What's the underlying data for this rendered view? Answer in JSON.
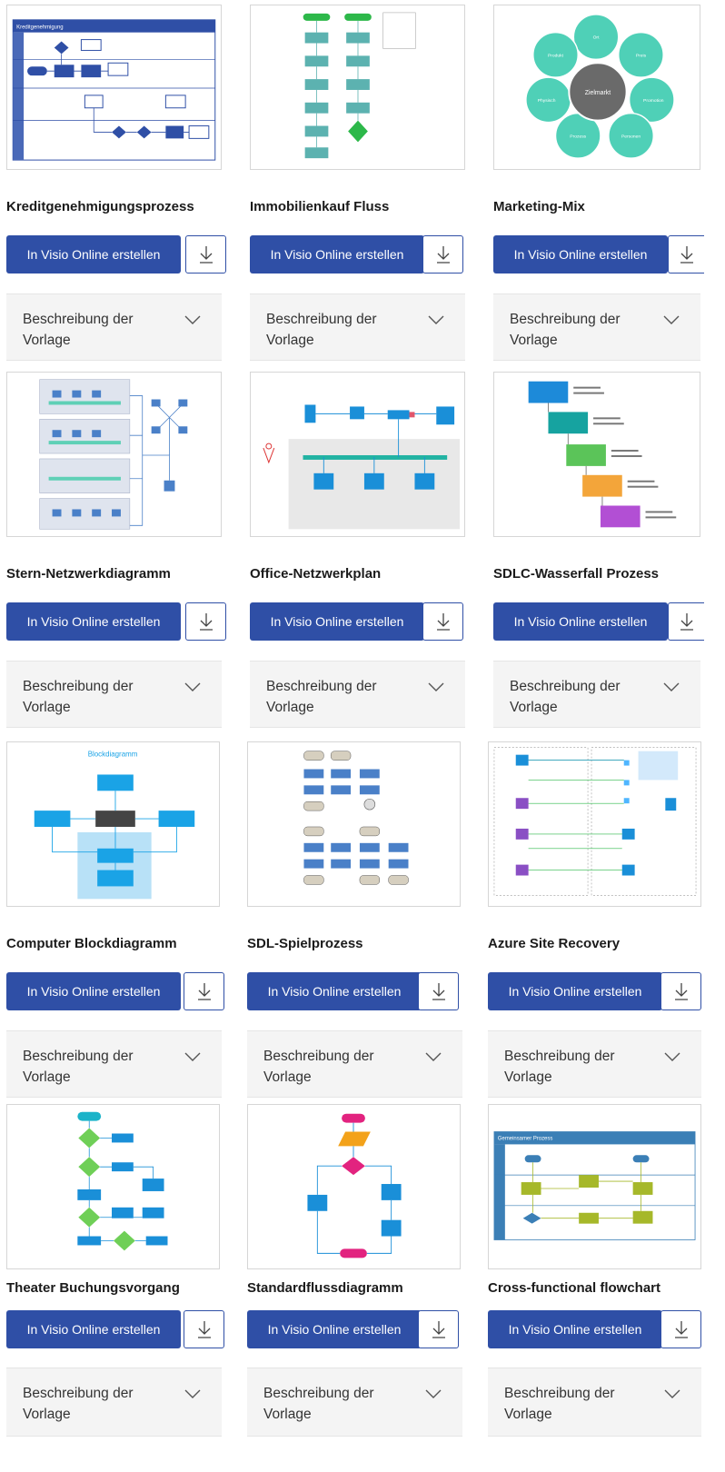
{
  "common": {
    "create_label": "In Visio Online erstellen",
    "description_label": "Beschreibung der Vorlage"
  },
  "templates": [
    {
      "title": "Kreditgenehmigungsprozess"
    },
    {
      "title": "Immobilienkauf Fluss"
    },
    {
      "title": "Marketing-Mix"
    },
    {
      "title": "Stern-Netzwerkdiagramm"
    },
    {
      "title": "Office-Netzwerkplan"
    },
    {
      "title": "SDLC-Wasserfall Prozess"
    },
    {
      "title": "Computer Blockdiagramm"
    },
    {
      "title": "SDL-Spielprozess"
    },
    {
      "title": "Azure Site Recovery"
    },
    {
      "title": "Theater Buchungsvorgang"
    },
    {
      "title": "Standardflussdiagramm"
    },
    {
      "title": "Cross-functional flowchart"
    }
  ],
  "thumbnails": {
    "kredit": {
      "header": "Kreditgenehmigung"
    },
    "marketing": {
      "center": "Zielmarkt",
      "segments": [
        "Ort",
        "Preis",
        "Promotion",
        "Personen",
        "Prozess",
        "Physisch",
        "Produkt"
      ]
    },
    "block": {
      "header": "Blockdiagramm"
    },
    "cross": {
      "header": "Gemeinsamer Prozess"
    }
  },
  "icons": {
    "download": "download-icon",
    "chevron": "chevron-down-icon"
  },
  "colors": {
    "accent": "#2f4fa6",
    "desc_bg": "#f4f4f4"
  }
}
